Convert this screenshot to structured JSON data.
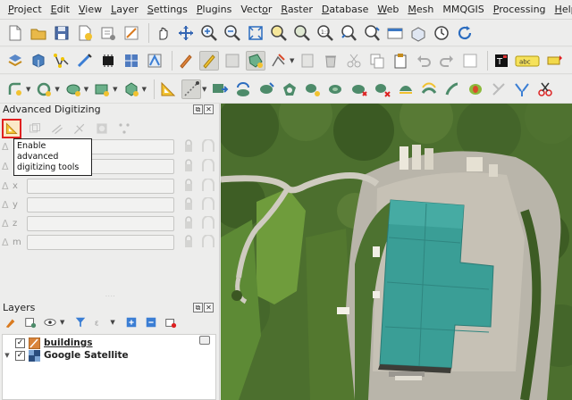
{
  "menu": {
    "items": [
      {
        "label": "Project",
        "mnemonic": "P",
        "rest": "roject"
      },
      {
        "label": "Edit",
        "mnemonic": "E",
        "rest": "dit"
      },
      {
        "label": "View",
        "mnemonic": "V",
        "rest": "iew"
      },
      {
        "label": "Layer",
        "mnemonic": "L",
        "rest": "ayer"
      },
      {
        "label": "Settings",
        "mnemonic": "S",
        "rest": "ettings"
      },
      {
        "label": "Plugins",
        "mnemonic": "P",
        "rest": "lugins"
      },
      {
        "label": "Vector",
        "mnemonic": "o",
        "pre": "Vect",
        "rest": "r"
      },
      {
        "label": "Raster",
        "mnemonic": "R",
        "rest": "aster"
      },
      {
        "label": "Database",
        "mnemonic": "D",
        "rest": "atabase"
      },
      {
        "label": "Web",
        "mnemonic": "W",
        "rest": "eb"
      },
      {
        "label": "Mesh",
        "mnemonic": "M",
        "rest": "esh"
      },
      {
        "label": "MMQGIS",
        "mnemonic": "",
        "rest": "MMQGIS"
      },
      {
        "label": "Processing",
        "mnemonic": "P",
        "rest": "rocessing"
      },
      {
        "label": "Help",
        "mnemonic": "H",
        "rest": "elp"
      }
    ]
  },
  "toolbar3": {
    "label_tool_text": "abc"
  },
  "advanced_digitizing": {
    "title": "Advanced Digitizing",
    "tooltip": "Enable advanced digitizing tools",
    "rows": [
      {
        "label": ""
      },
      {
        "label": ""
      },
      {
        "label": "x"
      },
      {
        "label": "y"
      },
      {
        "label": "z"
      },
      {
        "label": "m"
      }
    ]
  },
  "layers": {
    "title": "Layers",
    "items": [
      {
        "name": "buildings",
        "checked": true,
        "checkmark": "✓"
      },
      {
        "name": "Google Satellite",
        "checked": true,
        "checkmark": "✓"
      }
    ]
  },
  "colors": {
    "roof": "#3a9e96",
    "highlight": "#e02020",
    "grass": "#5a8a36"
  }
}
